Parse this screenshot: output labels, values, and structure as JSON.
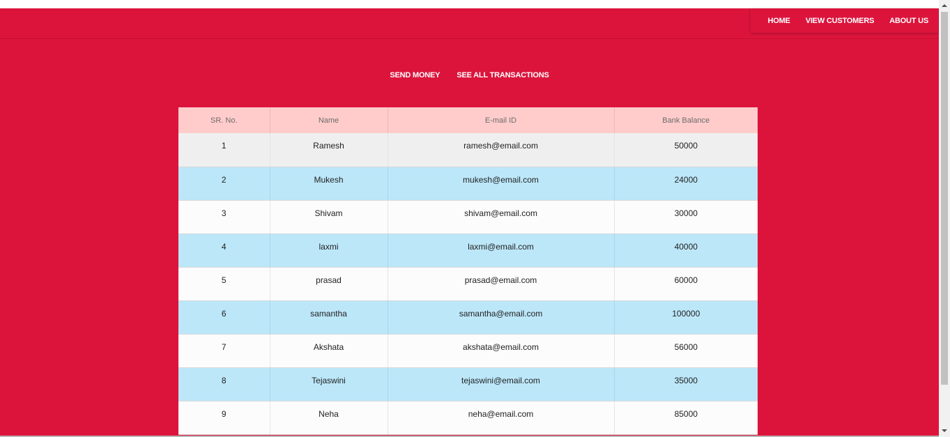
{
  "colors": {
    "page_background": "#dc143c",
    "table_header": "#ffcccb",
    "row_blue": "#bce7f9",
    "row_white": "#fcfcfc",
    "row_grey": "#efefef"
  },
  "nav": {
    "home": "HOME",
    "view_customers": "VIEW CUSTOMERS",
    "about_us": "ABOUT US"
  },
  "actions": {
    "send_money": "SEND MONEY",
    "see_all_transactions": "SEE ALL TRANSACTIONS"
  },
  "table": {
    "headers": {
      "sr_no": "SR. No.",
      "name": "Name",
      "email": "E-mail ID",
      "balance": "Bank Balance"
    },
    "rows": [
      {
        "sr": "1",
        "name": "Ramesh",
        "email": "ramesh@email.com",
        "balance": "50000",
        "style": "grey"
      },
      {
        "sr": "2",
        "name": "Mukesh",
        "email": "mukesh@email.com",
        "balance": "24000",
        "style": "blue"
      },
      {
        "sr": "3",
        "name": "Shivam",
        "email": "shivam@email.com",
        "balance": "30000",
        "style": "white"
      },
      {
        "sr": "4",
        "name": "laxmi",
        "email": "laxmi@email.com",
        "balance": "40000",
        "style": "blue"
      },
      {
        "sr": "5",
        "name": "prasad",
        "email": "prasad@email.com",
        "balance": "60000",
        "style": "white"
      },
      {
        "sr": "6",
        "name": "samantha",
        "email": "samantha@email.com",
        "balance": "100000",
        "style": "blue"
      },
      {
        "sr": "7",
        "name": "Akshata",
        "email": "akshata@email.com",
        "balance": "56000",
        "style": "white"
      },
      {
        "sr": "8",
        "name": "Tejaswini",
        "email": "tejaswini@email.com",
        "balance": "35000",
        "style": "blue"
      },
      {
        "sr": "9",
        "name": "Neha",
        "email": "neha@email.com",
        "balance": "85000",
        "style": "white"
      }
    ]
  }
}
